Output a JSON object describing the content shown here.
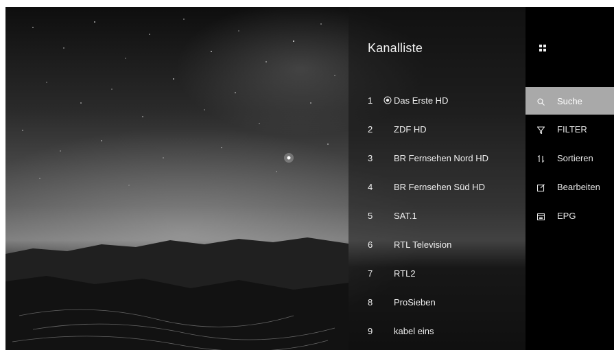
{
  "background": {
    "description_icon": "night-sky-photo"
  },
  "channel_list": {
    "title": "Kanalliste",
    "channels": [
      {
        "num": "1",
        "name": "Das Erste HD",
        "current": true
      },
      {
        "num": "2",
        "name": "ZDF HD"
      },
      {
        "num": "3",
        "name": "BR Fernsehen Nord HD"
      },
      {
        "num": "4",
        "name": "BR Fernsehen Süd HD"
      },
      {
        "num": "5",
        "name": "SAT.1"
      },
      {
        "num": "6",
        "name": "RTL Television"
      },
      {
        "num": "7",
        "name": "RTL2"
      },
      {
        "num": "8",
        "name": "ProSieben"
      },
      {
        "num": "9",
        "name": "kabel eins"
      }
    ]
  },
  "side_menu": {
    "items": [
      {
        "label": "Suche",
        "icon": "search-icon",
        "active": true
      },
      {
        "label": "FILTER",
        "icon": "filter-icon"
      },
      {
        "label": "Sortieren",
        "icon": "sort-icon"
      },
      {
        "label": "Bearbeiten",
        "icon": "edit-icon"
      },
      {
        "label": "EPG",
        "icon": "epg-icon"
      }
    ]
  },
  "colors": {
    "menu_active": "#a9a9a9",
    "menu_bg": "#000000"
  }
}
